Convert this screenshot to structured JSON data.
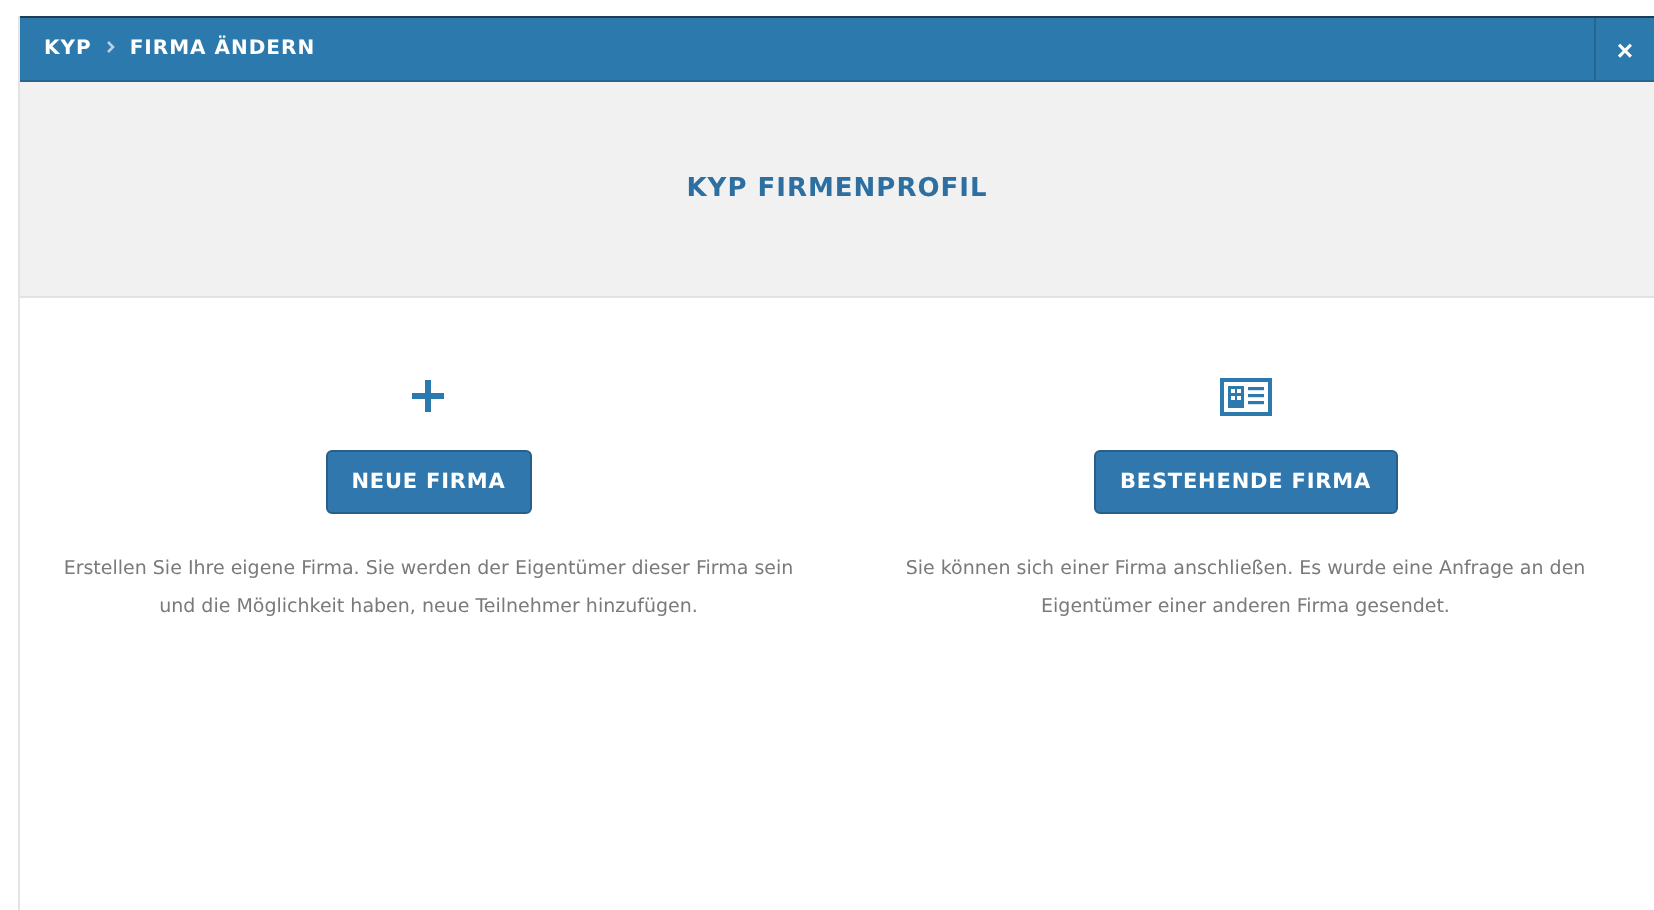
{
  "breadcrumb": [
    "KYP",
    "FIRMA ÄNDERN"
  ],
  "close": "×",
  "title": "KYP FIRMENPROFIL",
  "options": [
    {
      "kind": "plus",
      "button": "NEUE FIRMA",
      "description": "Erstellen Sie Ihre eigene Firma. Sie werden der Eigentümer dieser Firma sein und die Möglichkeit haben, neue Teilnehmer hinzufügen."
    },
    {
      "kind": "card",
      "button": "BESTEHENDE FIRMA",
      "description": "Sie können sich einer Firma anschließen. Es wurde eine Anfrage an den Eigentümer einer anderen Firma gesendet."
    }
  ]
}
